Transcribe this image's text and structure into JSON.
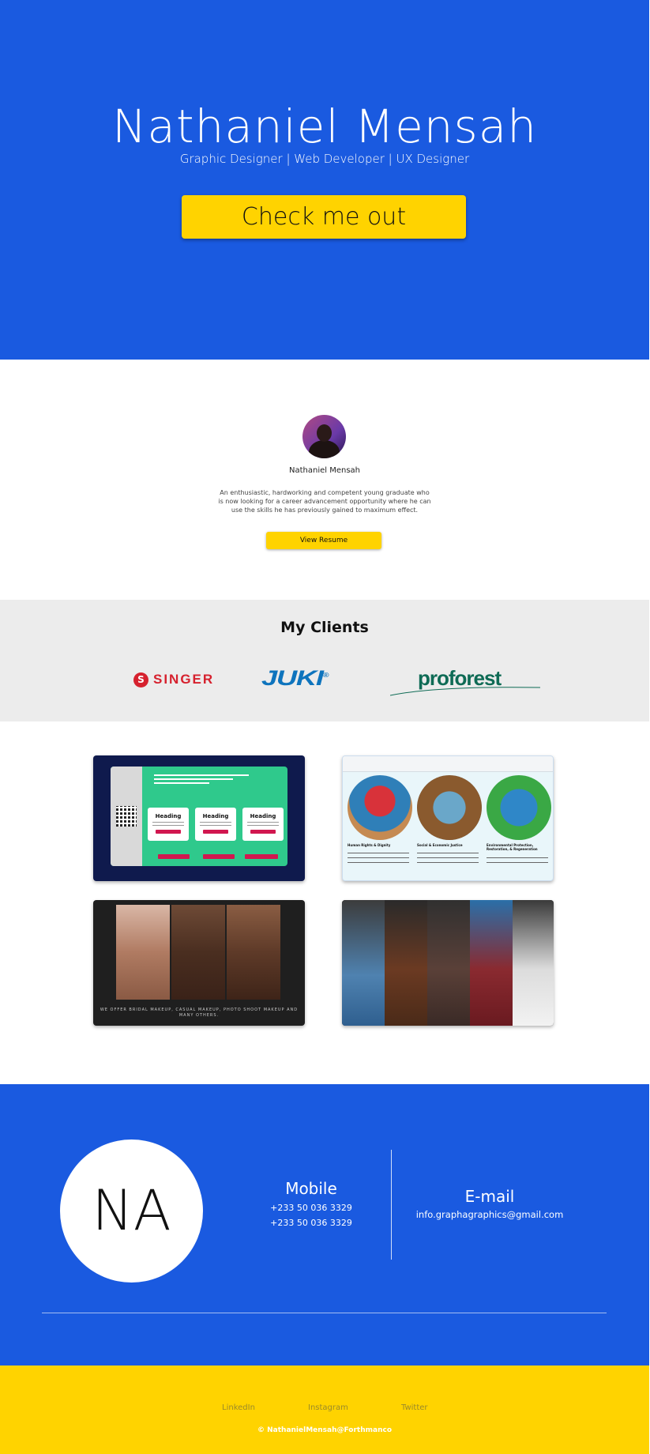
{
  "hero": {
    "title": "Nathaniel Mensah",
    "subtitle": "Graphic Designer | Web Developer | UX Designer",
    "cta_label": "Check me out"
  },
  "about": {
    "name": "Nathaniel Mensah",
    "description": "An enthusiastic, hardworking and competent young graduate who is now looking for a career advancement opportunity where he can use the skills he has previously gained to maximum effect.",
    "resume_label": "View Resume"
  },
  "clients": {
    "title": "My Clients",
    "logos": [
      {
        "name": "SINGER",
        "badge": "S"
      },
      {
        "name": "JUKI",
        "mark": "®"
      },
      {
        "name": "proforest"
      }
    ]
  },
  "portfolio": {
    "card1": {
      "minis": [
        "Heading",
        "Heading",
        "Heading"
      ]
    },
    "card2": {
      "captions": [
        "Human Rights & Dignity",
        "Social & Economic Justice",
        "Environmental Protection, Restoration, & Regeneration"
      ]
    },
    "card3": {
      "caption": "WE OFFER BRIDAL MAKEUP, CASUAL MAKEUP, PHOTO SHOOT MAKEUP AND MANY OTHERS."
    }
  },
  "contact": {
    "initials": "NA",
    "mobile_title": "Mobile",
    "mobile_numbers": [
      "+233 50 036 3329",
      "+233 50 036 3329"
    ],
    "email_title": "E-mail",
    "email": "info.graphagraphics@gmail.com"
  },
  "footer": {
    "links": [
      "LinkedIn",
      "Instagram",
      "Twitter"
    ],
    "copyright": "© NathanielMensah@Forthmanco"
  },
  "colors": {
    "brand_blue": "#1a5ae0",
    "accent_yellow": "#ffd300"
  }
}
